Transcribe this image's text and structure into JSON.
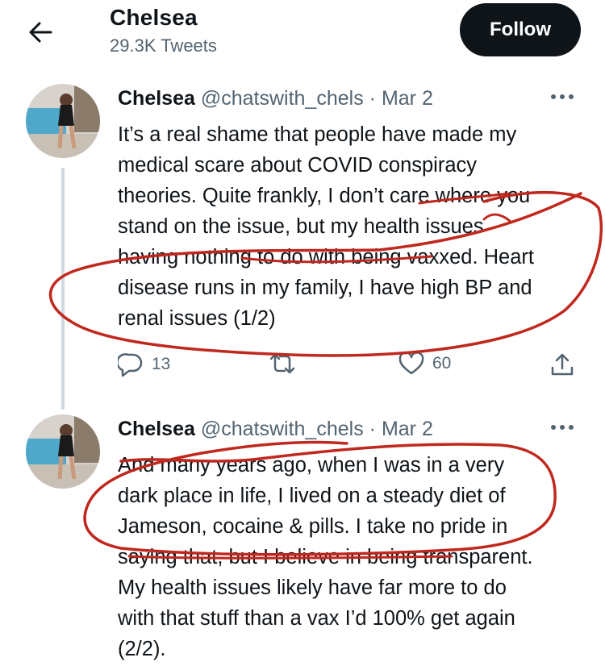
{
  "header": {
    "title": "Chelsea",
    "tweet_count": "29.3K Tweets",
    "follow_label": "Follow"
  },
  "tweets": [
    {
      "name": "Chelsea",
      "handle": "@chatswith_chels",
      "separator": "·",
      "date": "Mar 2",
      "body": "It’s a real shame that people have made my\nmedical scare about COVID conspiracy\ntheories. Quite frankly, I don’t care where you\nstand on the issue, but my health issues\nhaving nothing to do with being vaxxed. Heart\ndisease runs in my family, I have high BP and\nrenal issues (1/2)",
      "replies": "13",
      "likes": "60"
    },
    {
      "name": "Chelsea",
      "handle": "@chatswith_chels",
      "separator": "·",
      "date": "Mar 2",
      "body": "And many years ago, when I was in a very\ndark place in life, I lived on a steady diet of\nJameson, cocaine & pills. I take no pride in\nsaying that, but I believe in being transparent.\nMy health issues likely have far more to do\nwith that stuff than a vax I’d 100% get again\n(2/2)."
    }
  ],
  "colors": {
    "text": "#0f1419",
    "secondary": "#536471",
    "thread_line": "#cfd9de",
    "annotation": "#c0281e"
  },
  "icons": [
    "back-arrow-icon",
    "more-icon",
    "reply-icon",
    "retweet-icon",
    "like-icon",
    "share-icon"
  ]
}
